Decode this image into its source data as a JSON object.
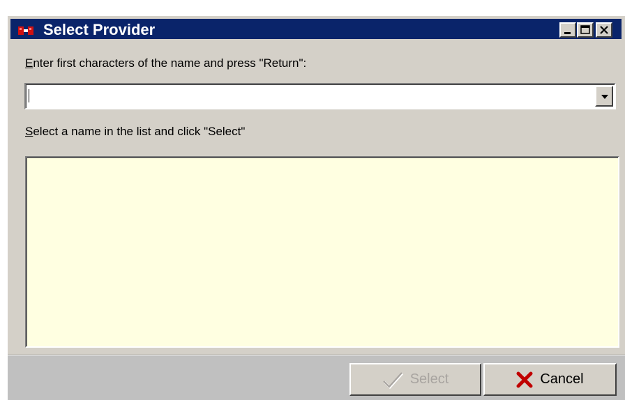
{
  "window": {
    "title": "Select Provider",
    "controls": [
      "minimize-icon",
      "maximize-icon",
      "close-icon"
    ]
  },
  "search": {
    "label_first_char": "E",
    "label_rest": "nter first characters of the name and press \"Return\":",
    "value": ""
  },
  "list": {
    "label_first_char": "S",
    "label_rest": "elect a name in the list and click \"Select\"",
    "items": [],
    "background": "#ffffe1"
  },
  "buttons": {
    "select_label": "Select",
    "select_enabled": false,
    "cancel_label": "Cancel"
  },
  "colors": {
    "titlebar": "#0a246a",
    "dialog": "#d4d0c8",
    "cancel_icon": "#c00000"
  }
}
